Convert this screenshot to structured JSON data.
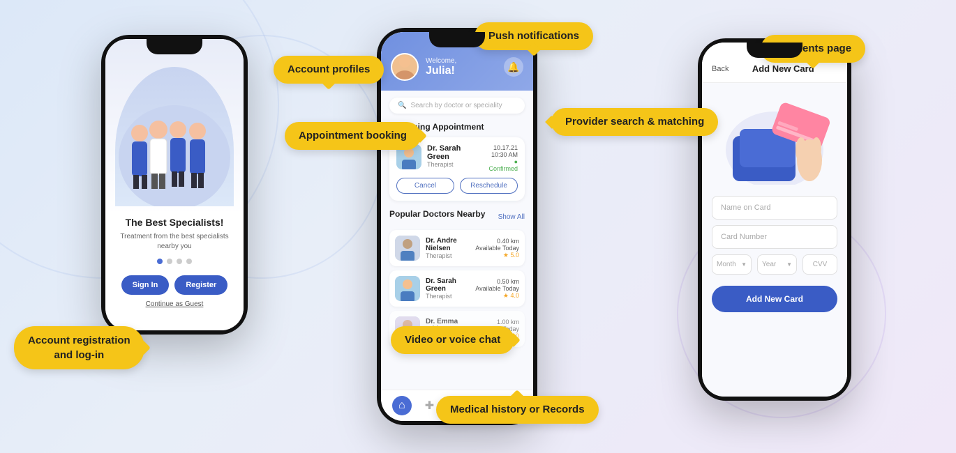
{
  "background": {
    "gradient_start": "#dce8f8",
    "gradient_end": "#f0e8f8"
  },
  "labels": {
    "push_notifications": "Push notifications",
    "account_profiles": "Account profiles",
    "appointment_booking": "Appointment booking",
    "provider_search": "Provider search & matching",
    "video_voice_chat": "Video or voice chat",
    "medical_history": "Medical history or Records",
    "account_registration": "Account registration\nand log-in",
    "payments_page": "Payments page"
  },
  "phone1": {
    "title": "The Best Specialists!",
    "subtitle": "Treatment from the best specialists nearby you",
    "signin_label": "Sign In",
    "register_label": "Register",
    "guest_label": "Continue as Guest"
  },
  "phone2": {
    "welcome": "Welcome,",
    "name": "Julia!",
    "search_placeholder": "Search by doctor or speciality",
    "upcoming_title": "Upcoming Appointment",
    "doctor1_name": "Dr. Sarah Green",
    "doctor1_role": "Therapist",
    "appointment_date": "10.17.21",
    "appointment_time": "10:30 AM",
    "appointment_status": "Confirmed",
    "cancel_label": "Cancel",
    "reschedule_label": "Reschedule",
    "popular_title": "Popular Doctors Nearby",
    "show_all": "Show All",
    "nearby1_name": "Dr. Andre Nielsen",
    "nearby1_role": "Therapist",
    "nearby1_dist": "0.40 km",
    "nearby1_avail": "Available Today",
    "nearby1_rating": "★ 5.0",
    "nearby2_name": "Dr. Sarah Green",
    "nearby2_role": "Therapist",
    "nearby2_dist": "0.50 km",
    "nearby2_avail": "Available Today",
    "nearby2_rating": "★ 4.0",
    "nearby3_dist": "1.00 km",
    "nearby3_avail": "Unavailable Today",
    "nearby3_rating": "★ 5.0"
  },
  "phone3": {
    "back_label": "Back",
    "title": "Add New Card",
    "name_placeholder": "Name on Card",
    "number_placeholder": "Card Number",
    "month_placeholder": "Month",
    "year_placeholder": "Year",
    "cvv_placeholder": "CVV",
    "add_button_label": "Add New Card"
  }
}
